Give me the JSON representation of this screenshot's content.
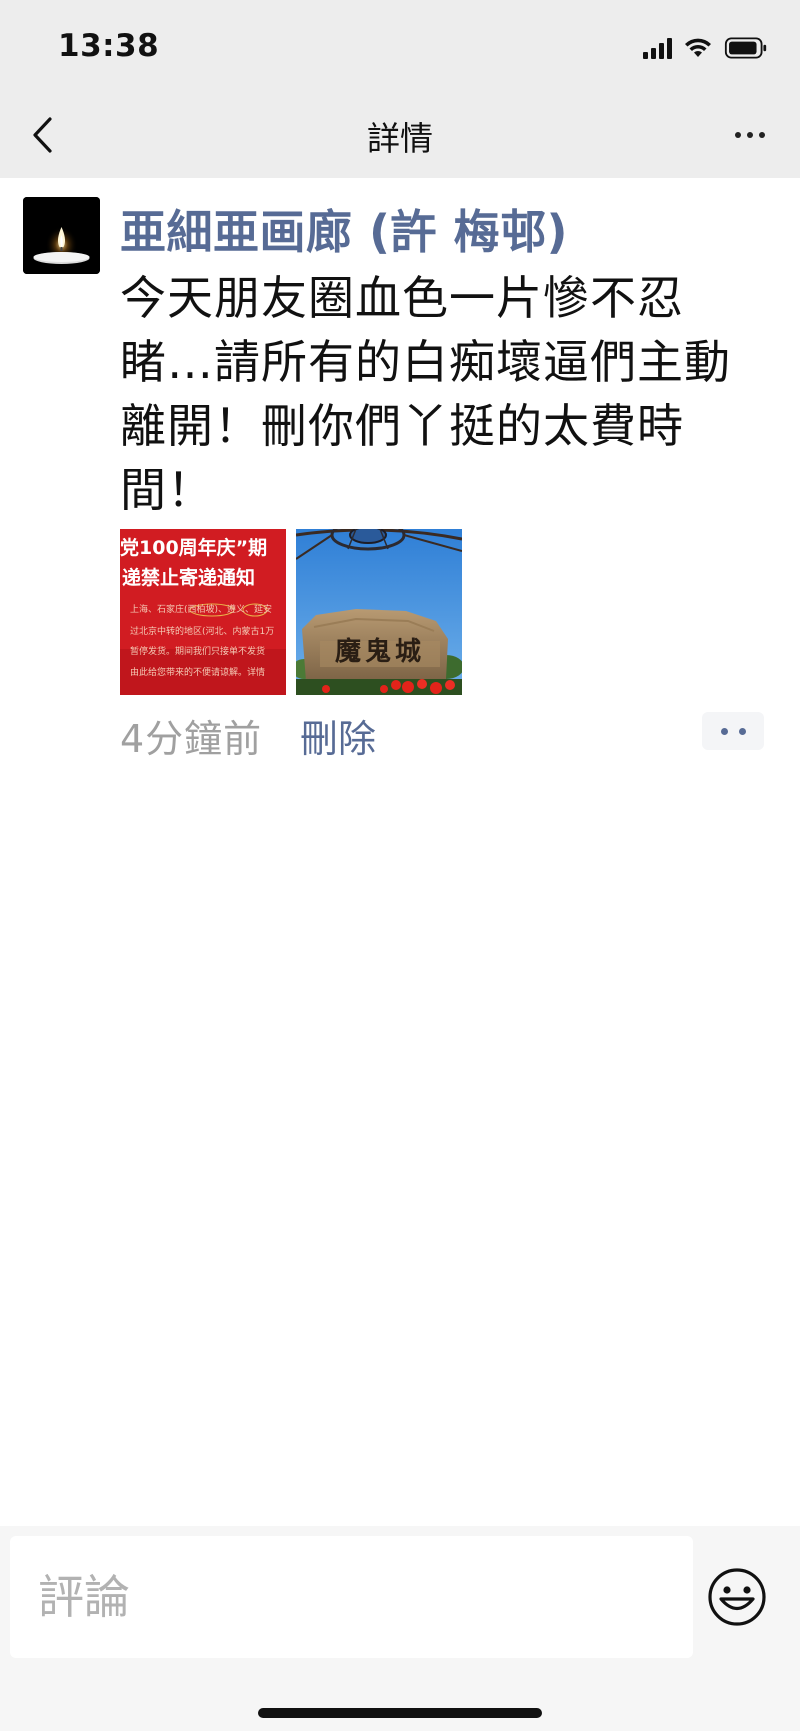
{
  "status_bar": {
    "time": "13:38",
    "icons": [
      "cellular-signal-icon",
      "wifi-icon",
      "battery-icon"
    ]
  },
  "nav": {
    "title": "詳情",
    "back_icon": "chevron-left-icon",
    "more_icon": "more-dots-icon"
  },
  "post": {
    "username": "亜細亜画廊 (許 梅邨)",
    "text": "今天朋友圈血色一片慘不忍睹…請所有的白痴壞逼們主動離開！刪你們丫挺的太費時間！",
    "images": [
      {
        "caption_lines": [
          "党100周年庆”期",
          "递禁止寄递通知",
          "上海、石家庄(西柏坡)、遵义、延安",
          "过北京中转的地区(河北、内蒙古1万",
          "暂停发货。期间我们只接单不发货",
          "由此给您带来的不便请谅解。详情"
        ]
      },
      {
        "sign_text": "魔鬼城"
      }
    ],
    "time_ago": "4分鐘前",
    "delete_label": "刪除"
  },
  "comment_bar": {
    "placeholder": "評論",
    "emoji_icon": "smiley-face-icon"
  },
  "colors": {
    "link": "#576b95",
    "nav_background": "#ededed",
    "meta_text": "#a0a0a0"
  }
}
